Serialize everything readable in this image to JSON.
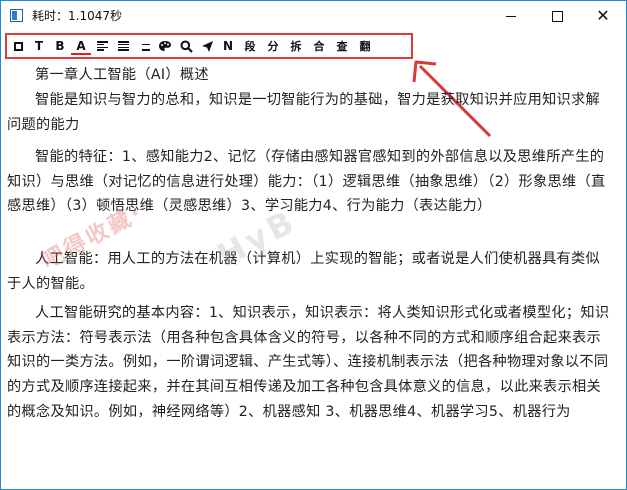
{
  "window": {
    "title": "耗时：1.1047秒",
    "minimize_symbol": "",
    "close_symbol": "✕"
  },
  "toolbar": {
    "bold_t": "T",
    "bold_b": "B",
    "color_a": "A",
    "paragraph": "N",
    "btn_duan": "段",
    "btn_fen": "分",
    "btn_chai": "拆",
    "btn_he": "合",
    "btn_cha": "查",
    "btn_fan": "翻",
    "frame_color": "#e23b3b"
  },
  "document": {
    "heading": "第一章人工智能（AI）概述",
    "paragraphs": [
      "智能是知识与智力的总和，知识是一切智能行为的基础，智力是获取知识并应用知识求解问题的能力",
      "智能的特征：1、感知能力2、记忆（存储由感知器官感知到的外部信息以及思维所产生的知识）与思维（对记忆的信息进行处理）能力：（1）逻辑思维（抽象思维）（2）形象思维（直感思维）（3）顿悟思维（灵感思维）3、学习能力4、行为能力（表达能力）",
      "人工智能：用人工的方法在机器（计算机）上实现的智能；或者说是人们使机器具有类似于人的智能。",
      "人工智能研究的基本内容：1、知识表示，知识表示：将人类知识形式化或者模型化；知识表示方法：符号表示法（用各种包含具体含义的符号，以各种不同的方式和顺序组合起来表示知识的一类方法。例如，一阶谓词逻辑、产生式等）、连接机制表示法（把各种物理对象以不同的方式及顺序连接起来，并在其间互相传递及加工各种包含具体意义的信息，以此来表示相关的概念及知识。例如，神经网络等）2、机器感知  3、机器思维4、机器学习5、机器行为"
    ]
  },
  "watermark": {
    "text_cn": "吧得收藏·",
    "text_en": "HyB"
  },
  "icons": [
    "app-icon",
    "square-icon",
    "align-left-icon",
    "align-justify-icon",
    "align-right-icon",
    "palette-icon",
    "search-icon",
    "send-icon",
    "annotation-arrow"
  ]
}
